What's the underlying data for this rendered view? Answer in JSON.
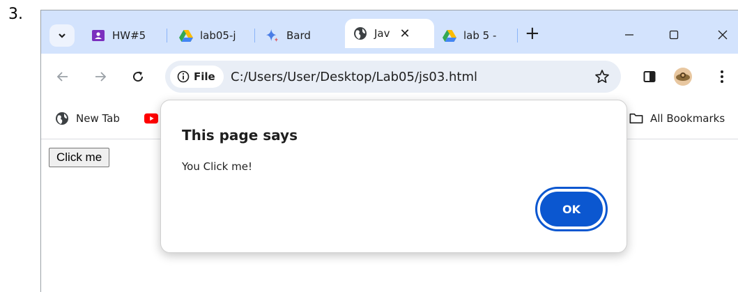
{
  "step_label": "3.",
  "tabs": [
    {
      "title": "HW#5",
      "icon": "classroom-icon"
    },
    {
      "title": "lab05-j",
      "icon": "google-drive-icon"
    },
    {
      "title": "Bard",
      "icon": "bard-sparkle-icon"
    },
    {
      "title": "Jav",
      "icon": "globe-icon",
      "active": true
    },
    {
      "title": "lab 5 -",
      "icon": "google-drive-icon"
    }
  ],
  "toolbar": {
    "site_info_label": "File",
    "url": "C:/Users/User/Desktop/Lab05/js03.html"
  },
  "bookmarks": {
    "items": [
      {
        "label": "New Tab",
        "icon": "globe-icon"
      },
      {
        "label": "",
        "icon": "youtube-icon"
      }
    ],
    "all_bookmarks_label": "All Bookmarks"
  },
  "page": {
    "button_label": "Click me"
  },
  "dialog": {
    "title": "This page says",
    "message": "You Click me!",
    "ok_label": "OK"
  },
  "colors": {
    "tabstrip_bg": "#d3e3fd",
    "omnibox_bg": "#e9eef6",
    "ok_button": "#0b57d0",
    "classroom_purple": "#7b2fbe",
    "youtube_red": "#ff0000"
  }
}
